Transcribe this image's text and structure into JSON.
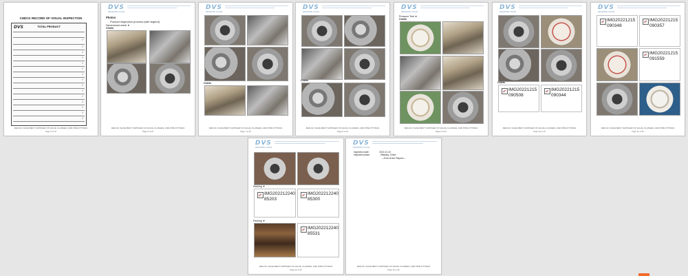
{
  "company": {
    "logo": "DVS",
    "logo_sub": "DEFENSE VALVE"
  },
  "footer_text": "DEN-SC VALVE BEST SUPPLIER OF VALVE, FLANGES, AND PIPE FITTINGS",
  "pages": [
    {
      "id": 1,
      "number": "Page 5 of 15",
      "title": "CHECK RECORD OF VISUAL INSPECTION",
      "sheet_title": "TOTAL PRODUCT",
      "checks": [
        "✓",
        "✓",
        "✓",
        "✓",
        "✓",
        "✓",
        "✓",
        "✓",
        "✓",
        "✓",
        "✓",
        "✓",
        "✓",
        "✓",
        "✓"
      ]
    },
    {
      "id": 2,
      "number": "Page 6 of 15",
      "section": "Photos",
      "bullet": "Product inspection process (with legend)",
      "caption1": "Dimensional check ▼",
      "caption2": "Chiefs"
    },
    {
      "id": 3,
      "number": "Page 7 of 15",
      "caption": "Chiefs"
    },
    {
      "id": 4,
      "number": "Page 8 of 15",
      "caption": "Chiefs"
    },
    {
      "id": 5,
      "number": "Page 9 of 15",
      "caption1": "Pressure Test ▼",
      "caption2": "Chiefs"
    },
    {
      "id": 6,
      "number": "Page 10 of 15",
      "caption": "Chiefs",
      "images": [
        "IMG20221215090508",
        "IMG20221215090344"
      ]
    },
    {
      "id": 7,
      "number": "Page 11 of 15",
      "images": [
        "IMG20221215090348",
        "IMG20221215090357",
        "IMG20221215091559"
      ]
    },
    {
      "id": 8,
      "number": "Page 12 of 15",
      "caption1": "Marking ▼",
      "caption2": "Packing ▼",
      "images": [
        "IMG20221224085203",
        "IMG20221224085300",
        "IMG20221224085531"
      ]
    },
    {
      "id": 9,
      "number": "Page 13 of 15",
      "kv": [
        {
          "k": "Inspection date:",
          "v": "2022-12-15"
        },
        {
          "k": "Inspection place:",
          "v": "Zhejiang, China"
        }
      ],
      "end_text": "—End of the Report—"
    }
  ]
}
